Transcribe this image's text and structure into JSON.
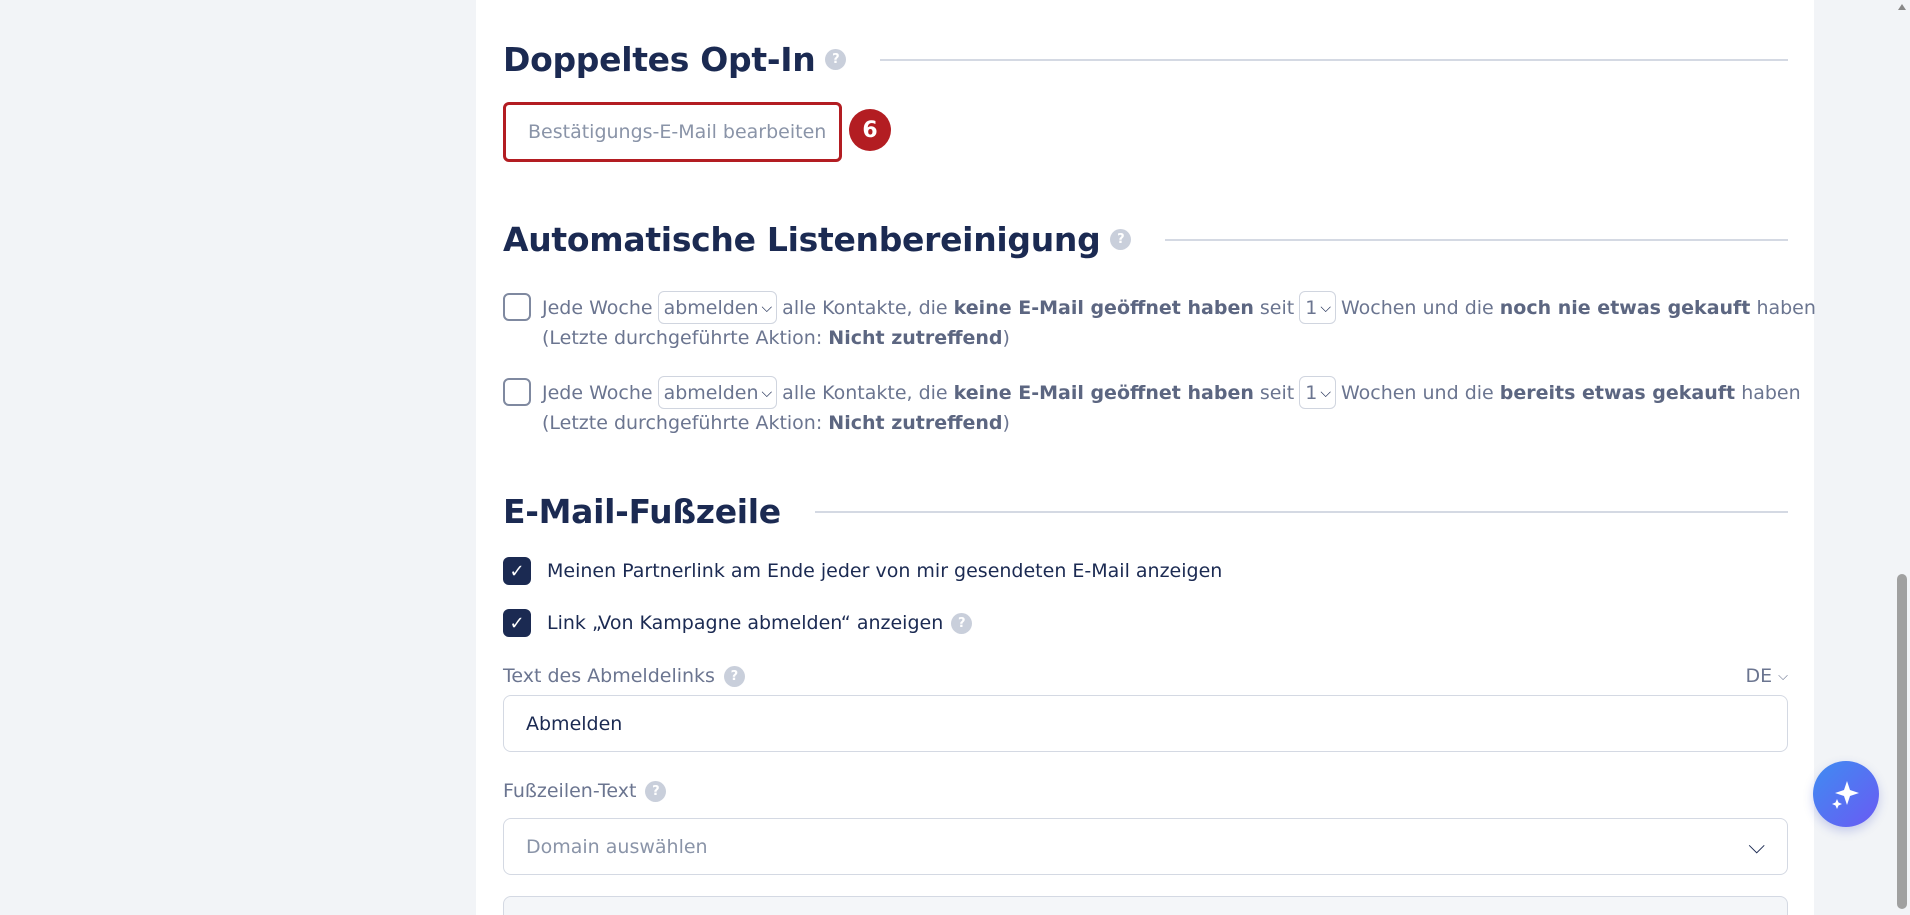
{
  "double_opt_in": {
    "title": "Doppeltes Opt-In",
    "help": "?",
    "edit_button": "Bestätigungs-E-Mail bearbeiten",
    "step_badge": "6"
  },
  "list_cleanup": {
    "title": "Automatische Listenbereinigung",
    "help": "?",
    "rules": [
      {
        "checked": false,
        "every_week": "Jede Woche",
        "action": "abmelden",
        "all_contacts": "alle Kontakte, die",
        "no_email_opened": "keine E-Mail geöffnet haben",
        "since": "seit",
        "weeks": "1",
        "weeks_and": "Wochen und die",
        "purchase": "noch nie etwas gekauft",
        "have": "haben",
        "last_action_prefix": "(Letzte durchgeführte Aktion:",
        "last_action_value": "Nicht zutreffend",
        "last_action_suffix": ")"
      },
      {
        "checked": false,
        "every_week": "Jede Woche",
        "action": "abmelden",
        "all_contacts": "alle Kontakte, die",
        "no_email_opened": "keine E-Mail geöffnet haben",
        "since": "seit",
        "weeks": "1",
        "weeks_and": "Wochen und die",
        "purchase": "bereits etwas gekauft",
        "have": "haben",
        "last_action_prefix": "(Letzte durchgeführte Aktion:",
        "last_action_value": "Nicht zutreffend",
        "last_action_suffix": ")"
      }
    ]
  },
  "footer": {
    "title": "E-Mail-Fußzeile",
    "partner_link_label": "Meinen Partnerlink am Ende jeder von mir gesendeten E-Mail anzeigen",
    "partner_link_checked": true,
    "unsubscribe_link_label": "Link „Von Kampagne abmelden“ anzeigen",
    "unsubscribe_link_checked": true,
    "unsubscribe_text_label": "Text des Abmeldelinks",
    "language": "DE",
    "unsubscribe_text_value": "Abmelden",
    "footer_text_label": "Fußzeilen-Text",
    "domain_placeholder": "Domain auswählen",
    "help": "?"
  },
  "colors": {
    "heading": "#1b2a52",
    "accent_red": "#b31d22",
    "checkbox_checked": "#1b2a52"
  },
  "icons": {
    "help": "help-circle-icon",
    "check": "check-icon",
    "chevron": "chevron-down-icon",
    "assistant": "sparkle-icon"
  }
}
